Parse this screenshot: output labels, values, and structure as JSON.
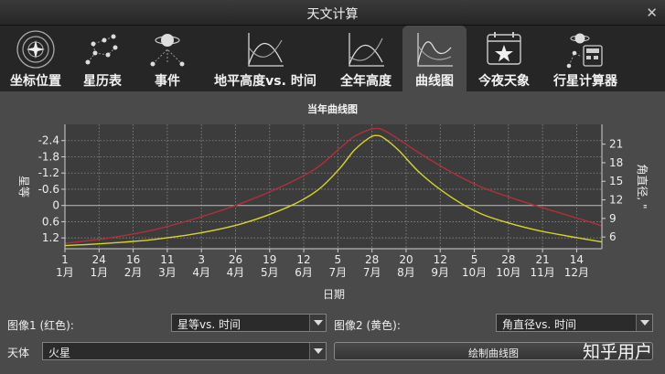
{
  "window": {
    "title": "天文计算",
    "close_glyph": "✕"
  },
  "tabs": [
    {
      "label": "坐标位置",
      "icon": "coordinate-icon"
    },
    {
      "label": "星历表",
      "icon": "ephemeris-icon"
    },
    {
      "label": "事件",
      "icon": "event-icon"
    },
    {
      "label": "地平高度vs. 时间",
      "icon": "altitude-time-icon"
    },
    {
      "label": "全年高度",
      "icon": "yearly-altitude-icon"
    },
    {
      "label": "曲线图",
      "icon": "graph-icon",
      "active": true
    },
    {
      "label": "今夜天象",
      "icon": "calendar-star-icon"
    },
    {
      "label": "行星计算器",
      "icon": "planet-calculator-icon"
    }
  ],
  "plot": {
    "title": "当年曲线图"
  },
  "chart_data": {
    "type": "line",
    "xlabel": "日期",
    "ylabel_left": "星等",
    "ylabel_right": "角直径, \"",
    "x_ticks": [
      {
        "top": "1",
        "bottom": "1月"
      },
      {
        "top": "24",
        "bottom": "1月"
      },
      {
        "top": "16",
        "bottom": "2月"
      },
      {
        "top": "11",
        "bottom": "3月"
      },
      {
        "top": "3",
        "bottom": "4月"
      },
      {
        "top": "26",
        "bottom": "4月"
      },
      {
        "top": "19",
        "bottom": "5月"
      },
      {
        "top": "12",
        "bottom": "6月"
      },
      {
        "top": "5",
        "bottom": "7月"
      },
      {
        "top": "28",
        "bottom": "7月"
      },
      {
        "top": "20",
        "bottom": "8月"
      },
      {
        "top": "12",
        "bottom": "9月"
      },
      {
        "top": "5",
        "bottom": "10月"
      },
      {
        "top": "28",
        "bottom": "10月"
      },
      {
        "top": "21",
        "bottom": "11月"
      },
      {
        "top": "14",
        "bottom": "12月"
      }
    ],
    "x_tick_days": [
      0,
      23,
      46,
      69,
      92,
      115,
      138,
      161,
      184,
      207,
      230,
      253,
      276,
      299,
      322,
      345
    ],
    "x_range_days": [
      0,
      362
    ],
    "y_left_ticks": [
      "-2.4",
      "-1.8",
      "-1.2",
      "-0.6",
      "0",
      "0.6",
      "1.2"
    ],
    "y_left_values": [
      -2.4,
      -1.8,
      -1.2,
      -0.6,
      0,
      0.6,
      1.2
    ],
    "y_left_range": [
      1.6,
      -3.0
    ],
    "y_right_ticks": [
      "21",
      "18",
      "15",
      "12",
      "9",
      "6"
    ],
    "y_right_values": [
      21,
      18,
      15,
      12,
      9,
      6
    ],
    "y_right_range": [
      4.1,
      24.2
    ],
    "grid": true,
    "series": [
      {
        "axis": "left",
        "color": "#b0303a",
        "points": [
          [
            0,
            1.4
          ],
          [
            30,
            1.2
          ],
          [
            60,
            0.9
          ],
          [
            90,
            0.45
          ],
          [
            120,
            -0.1
          ],
          [
            150,
            -0.8
          ],
          [
            170,
            -1.4
          ],
          [
            185,
            -2.1
          ],
          [
            195,
            -2.55
          ],
          [
            205,
            -2.8
          ],
          [
            210,
            -2.85
          ],
          [
            215,
            -2.78
          ],
          [
            225,
            -2.45
          ],
          [
            240,
            -1.9
          ],
          [
            260,
            -1.25
          ],
          [
            280,
            -0.7
          ],
          [
            300,
            -0.3
          ],
          [
            320,
            0.05
          ],
          [
            340,
            0.38
          ],
          [
            362,
            0.75
          ]
        ]
      },
      {
        "axis": "right",
        "color": "#d8d428",
        "points": [
          [
            0,
            4.6
          ],
          [
            30,
            5.0
          ],
          [
            60,
            5.6
          ],
          [
            90,
            6.6
          ],
          [
            120,
            8.2
          ],
          [
            150,
            10.8
          ],
          [
            170,
            13.5
          ],
          [
            185,
            17.0
          ],
          [
            195,
            20.0
          ],
          [
            205,
            22.0
          ],
          [
            210,
            22.4
          ],
          [
            215,
            22.0
          ],
          [
            225,
            20.0
          ],
          [
            240,
            16.2
          ],
          [
            260,
            12.5
          ],
          [
            280,
            9.8
          ],
          [
            300,
            8.2
          ],
          [
            320,
            7.0
          ],
          [
            340,
            6.1
          ],
          [
            362,
            5.2
          ]
        ]
      }
    ]
  },
  "controls": {
    "image1_label": "图像1 (红色):",
    "image1_value": "星等vs. 时间",
    "image2_label": "图像2 (黄色):",
    "image2_value": "角直径vs. 时间",
    "body_label": "天体",
    "body_value": "火星",
    "plot_button": "绘制曲线图"
  },
  "watermark": "知乎用户"
}
